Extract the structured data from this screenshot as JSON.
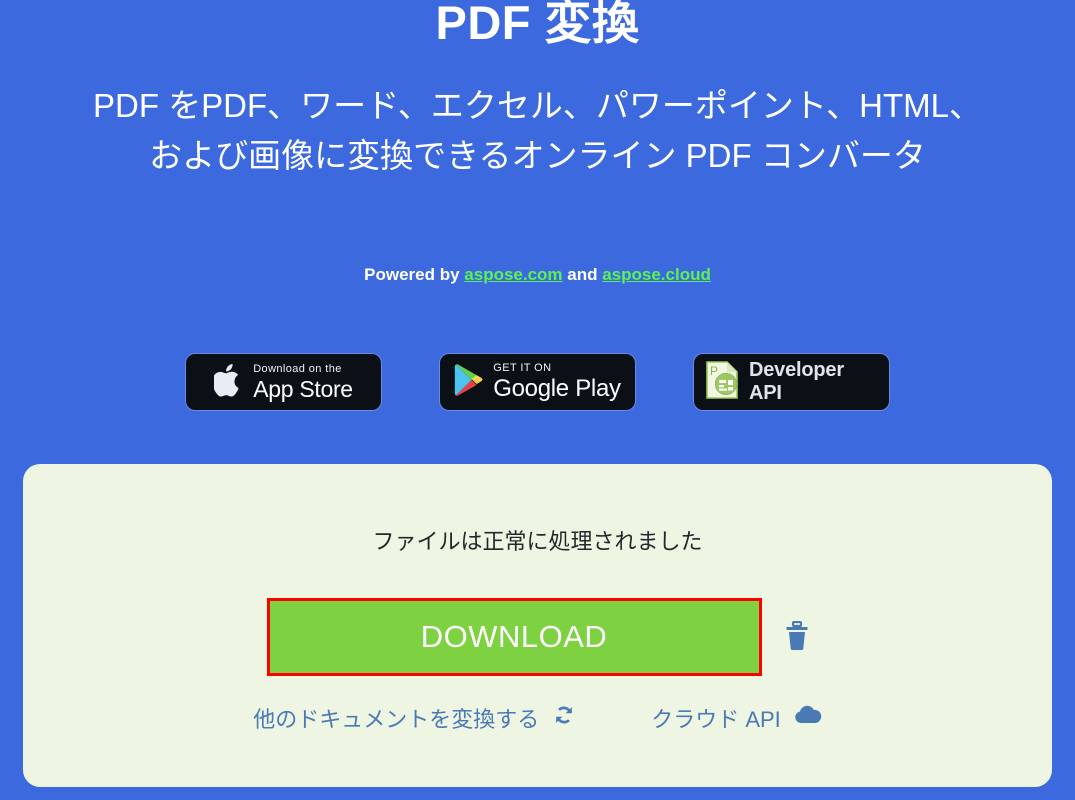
{
  "header": {
    "title": "PDF 変換",
    "subtitle": "PDF をPDF、ワード、エクセル、パワーポイント、HTML、および画像に変換できるオンライン PDF コンバータ",
    "powered_prefix": "Powered by ",
    "powered_link1": "aspose.com",
    "powered_middle": " and ",
    "powered_link2": "aspose.cloud",
    "link_color": "#5cf24f",
    "background_color": "#3c6ade"
  },
  "badges": {
    "app_store": {
      "small": "Download on the",
      "big": "App Store",
      "icon": "apple-logo-icon"
    },
    "google_play": {
      "small": "GET IT ON",
      "big": "Google Play",
      "icon": "google-play-triangle-icon"
    },
    "developer_api": {
      "label": "Developer API",
      "icon": "aspose-product-icon"
    }
  },
  "card": {
    "background_color": "#eef5e3",
    "status_message": "ファイルは正常に処理されました",
    "download_label": "DOWNLOAD",
    "download_color": "#7ed242",
    "highlight_color": "#ff0000",
    "delete_icon": "trash-icon",
    "links": [
      {
        "label": "他のドキュメントを変換する",
        "icon": "refresh-icon"
      },
      {
        "label": "クラウド API",
        "icon": "cloud-icon"
      }
    ],
    "link_color": "#4a7ab5"
  }
}
